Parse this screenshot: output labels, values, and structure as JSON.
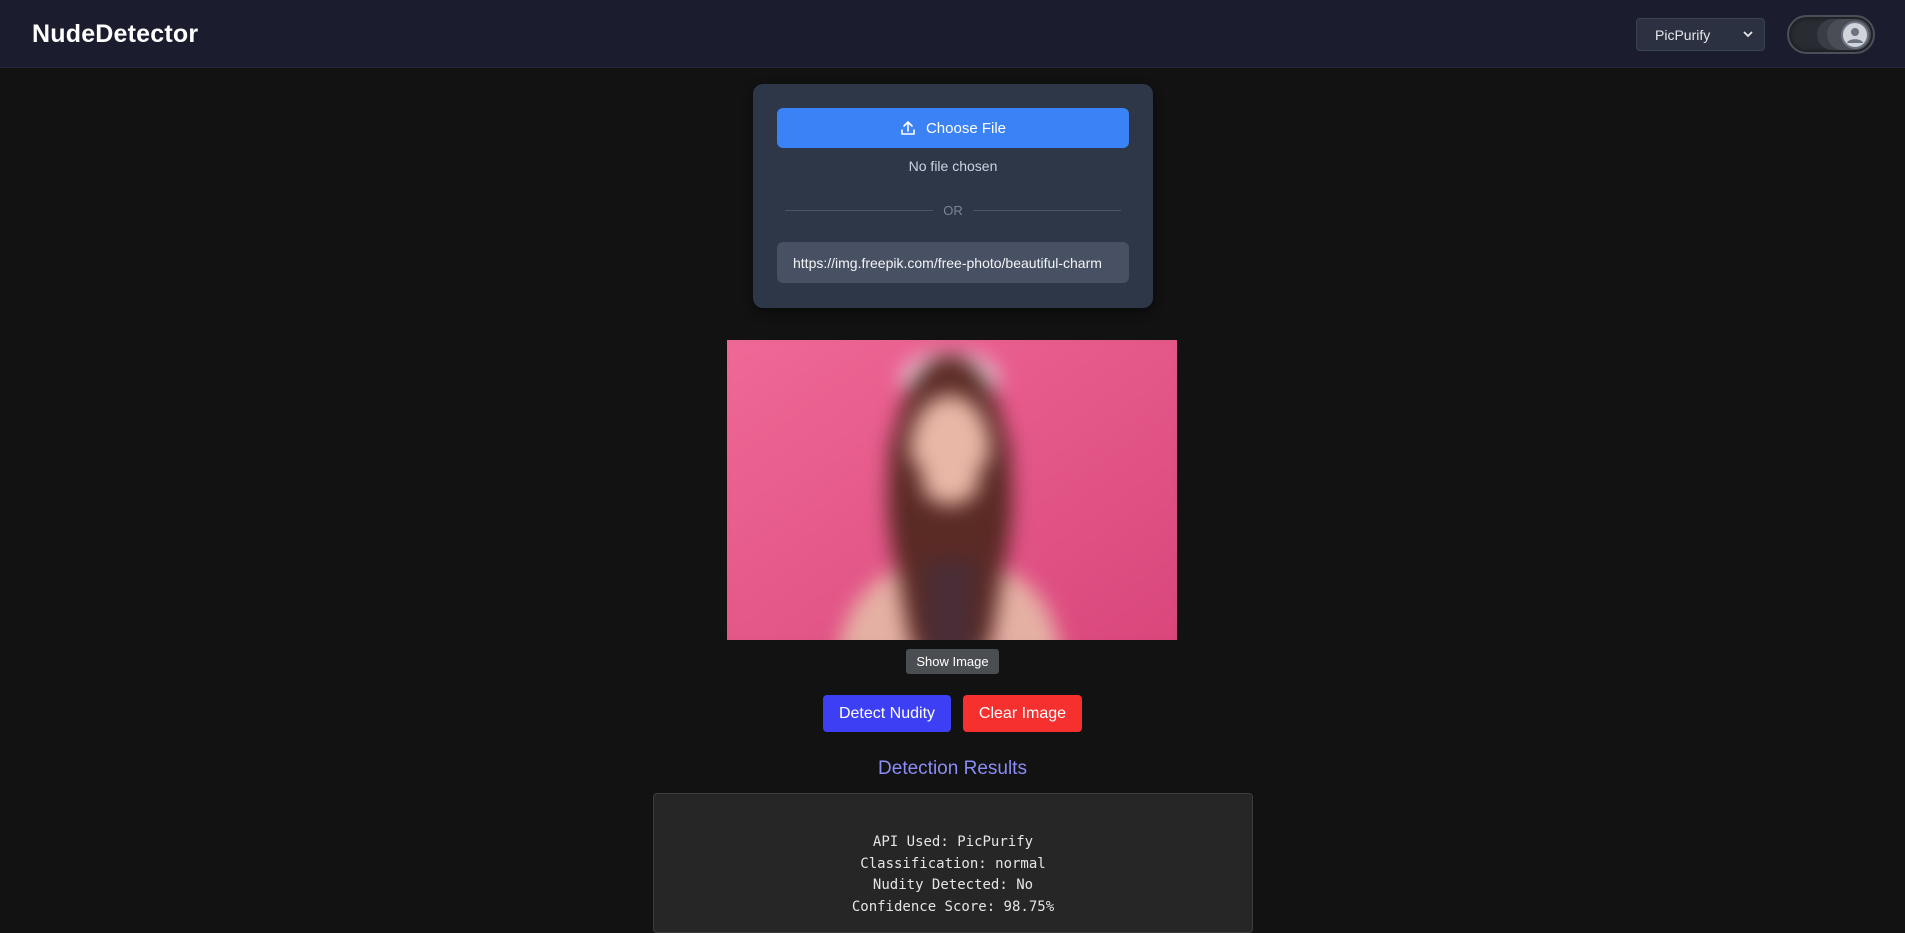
{
  "header": {
    "brand": "NudeDetector",
    "api_select": {
      "selected": "PicPurify",
      "icon": "chevron-down-icon"
    },
    "theme_toggle": {
      "icon": "user-avatar-icon",
      "state": "on"
    }
  },
  "upload": {
    "choose_file_label": "Choose File",
    "choose_file_icon": "upload-icon",
    "no_file_text": "No file chosen",
    "or_text": "OR",
    "url_value": "https://img.freepik.com/free-photo/beautiful-charm"
  },
  "preview": {
    "show_image_label": "Show Image"
  },
  "actions": {
    "detect_label": "Detect Nudity",
    "clear_label": "Clear Image"
  },
  "results": {
    "title": "Detection Results",
    "lines": [
      "API Used: PicPurify",
      "Classification: normal",
      "Nudity Detected: No",
      "Confidence Score: 98.75%"
    ]
  },
  "colors": {
    "accent_blue": "#3b82f6",
    "detect_button": "#3d3ff5",
    "clear_button": "#f5302f",
    "results_title": "#8b8cf5",
    "header_bg": "#1b1d2e",
    "page_bg": "#121212"
  }
}
